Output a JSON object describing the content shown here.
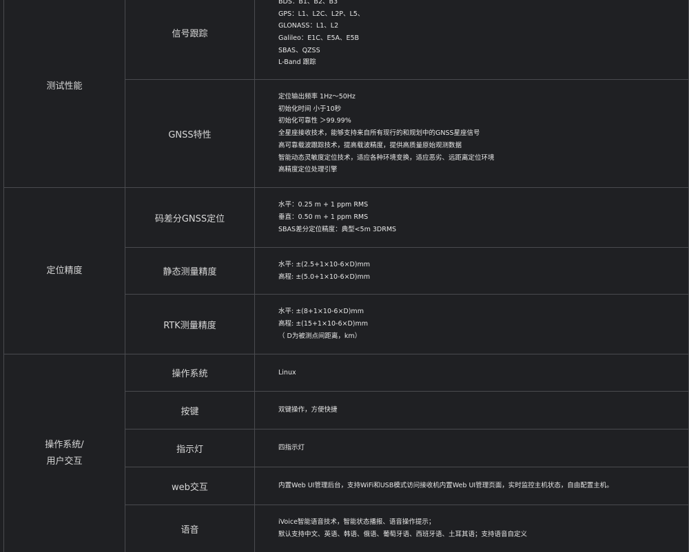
{
  "rows": {
    "signal": {
      "label": "信号跟踪",
      "lines": [
        "BDS：B1、B2、B3",
        "GPS：L1、L2C、L2P、L5、",
        "GLONASS：L1、L2",
        "Galileo：E1C、E5A、E5B",
        "SBAS、QZSS",
        "L-Band 跟踪"
      ]
    },
    "gnss": {
      "label": "GNSS特性",
      "lines": [
        "定位输出频率 1Hz～50Hz",
        "初始化时间 小于10秒",
        "初始化可靠性 ＞99.99%",
        "全星座接收技术，能够支持来自所有现行的和规划中的GNSS星座信号",
        "高可靠载波跟踪技术，提高载波精度，提供高质量原始观测数据",
        "智能动态灵敏度定位技术，适应各种环境变换，适应恶劣、远距离定位环境",
        "高精度定位处理引擎"
      ]
    },
    "code_diff": {
      "label": "码差分GNSS定位",
      "lines": [
        "水平：0.25 m + 1 ppm RMS",
        "垂直：0.50 m + 1 ppm RMS",
        "SBAS差分定位精度：典型<5m 3DRMS"
      ]
    },
    "static": {
      "label": "静态测量精度",
      "lines": [
        "水平: ±(2.5+1×10-6×D)mm",
        "高程: ±(5.0+1×10-6×D)mm"
      ]
    },
    "rtk": {
      "label": "RTK测量精度",
      "lines": [
        "水平: ±(8+1×10-6×D)mm",
        "高程: ±(15+1×10-6×D)mm",
        "（ D为被测点间距离，km）"
      ]
    },
    "os": {
      "label": "操作系统",
      "value": "Linux"
    },
    "keys": {
      "label": "按键",
      "value": "双键操作，方便快捷"
    },
    "led": {
      "label": "指示灯",
      "value": "四指示灯"
    },
    "web": {
      "label": "web交互",
      "value": "内置Web UI管理后台，支持WiFi和USB模式访问接收机内置Web UI管理页面，实时监控主机状态，自由配置主机。"
    },
    "voice": {
      "label": "语音",
      "lines": [
        "iVoice智能语音技术，智能状态播报、语音操作提示；",
        "默认支持中文、英语、韩语、俄语、葡萄牙语、西班牙语、土耳其语；支持语音自定义"
      ]
    }
  },
  "categories": {
    "performance": "测试性能",
    "accuracy": "定位精度",
    "system_line1": "操作系统/",
    "system_line2": "用户交互"
  }
}
